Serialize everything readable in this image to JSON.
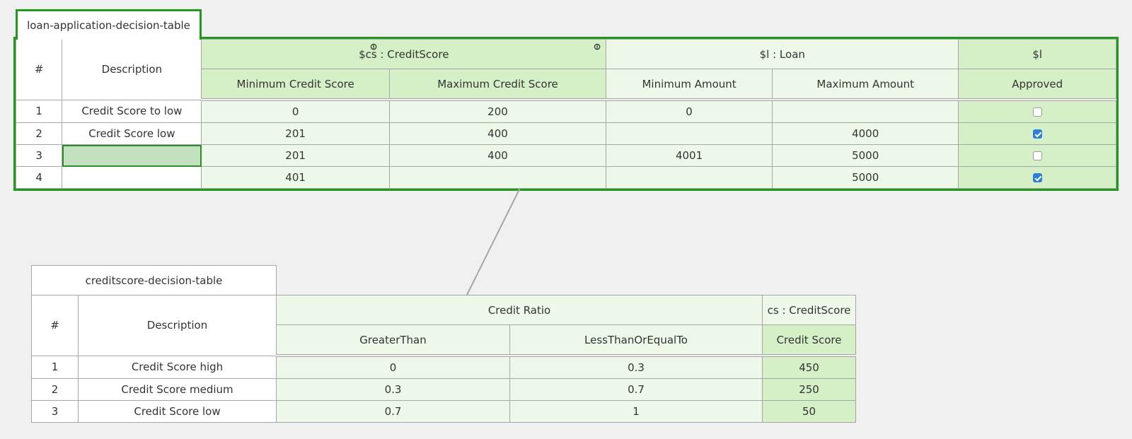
{
  "loan_table": {
    "name": "loan-application-decision-table",
    "hash_header": "#",
    "description_header": "Description",
    "groups": {
      "cs": "$cs : CreditScore",
      "loan": "$l : Loan",
      "action": "$l"
    },
    "columns": [
      "Minimum  Credit Score",
      "Maximum Credit Score",
      "Minimum Amount",
      "Maximum Amount",
      "Approved"
    ],
    "rows": [
      {
        "num": "1",
        "desc": "Credit Score to low",
        "min_cs": "0",
        "max_cs": "200",
        "min_amt": "0",
        "max_amt": "",
        "approved": false
      },
      {
        "num": "2",
        "desc": "Credit Score low",
        "min_cs": "201",
        "max_cs": "400",
        "min_amt": "",
        "max_amt": "4000",
        "approved": true
      },
      {
        "num": "3",
        "desc": "",
        "min_cs": "201",
        "max_cs": "400",
        "min_amt": "4001",
        "max_amt": "5000",
        "approved": false
      },
      {
        "num": "4",
        "desc": "",
        "min_cs": "401",
        "max_cs": "",
        "min_amt": "",
        "max_amt": "5000",
        "approved": true
      }
    ]
  },
  "credit_table": {
    "name": "creditscore-decision-table",
    "hash_header": "#",
    "description_header": "Description",
    "groups": {
      "ratio": "Credit Ratio",
      "score": "cs : CreditScore"
    },
    "columns": [
      "GreaterThan",
      "LessThanOrEqualTo",
      "Credit Score"
    ],
    "rows": [
      {
        "num": "1",
        "desc": "Credit Score high",
        "gt": "0",
        "lte": "0.3",
        "score": "450"
      },
      {
        "num": "2",
        "desc": "Credit Score medium",
        "gt": "0.3",
        "lte": "0.7",
        "score": "250"
      },
      {
        "num": "3",
        "desc": "Credit Score low",
        "gt": "0.7",
        "lte": "1",
        "score": "50"
      }
    ]
  },
  "colors": {
    "selected_border": "#22991e",
    "condition_fill": "#eef8e8",
    "highlight_fill": "#d5efc7",
    "checkbox_checked": "#2f7fd8"
  },
  "icons": {
    "link": "link-icon"
  }
}
